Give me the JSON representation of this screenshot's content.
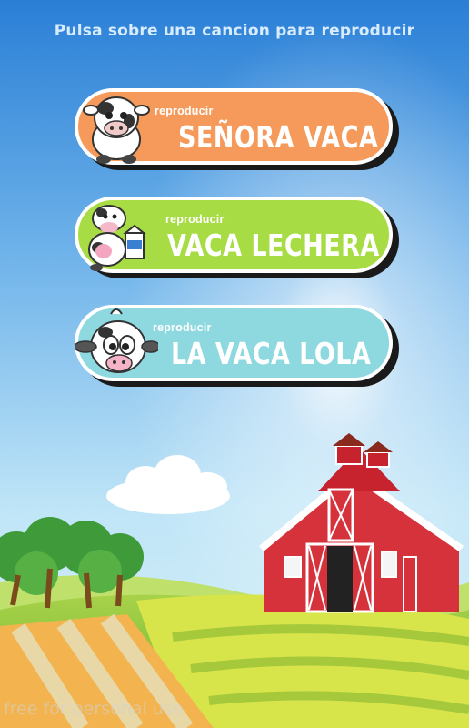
{
  "header": {
    "instruction": "Pulsa sobre una cancion para reproducir"
  },
  "songs": [
    {
      "label": "reproducir",
      "title": "SEÑORA VACA",
      "color": "#f59a5a",
      "mascot": "cow-face-icon"
    },
    {
      "label": "reproducir",
      "title": "VACA LECHERA",
      "color": "#a8dc45",
      "mascot": "cow-with-milk-icon"
    },
    {
      "label": "reproducir",
      "title": "LA VACA LOLA",
      "color": "#8ed8e0",
      "mascot": "cartoon-cow-head-icon"
    }
  ],
  "watermark": "free for personal use",
  "colors": {
    "sky_top": "#2a7fd6",
    "sky_bottom": "#b9e2f5",
    "grass": "#9fcf3c",
    "barn": "#d6323b"
  }
}
